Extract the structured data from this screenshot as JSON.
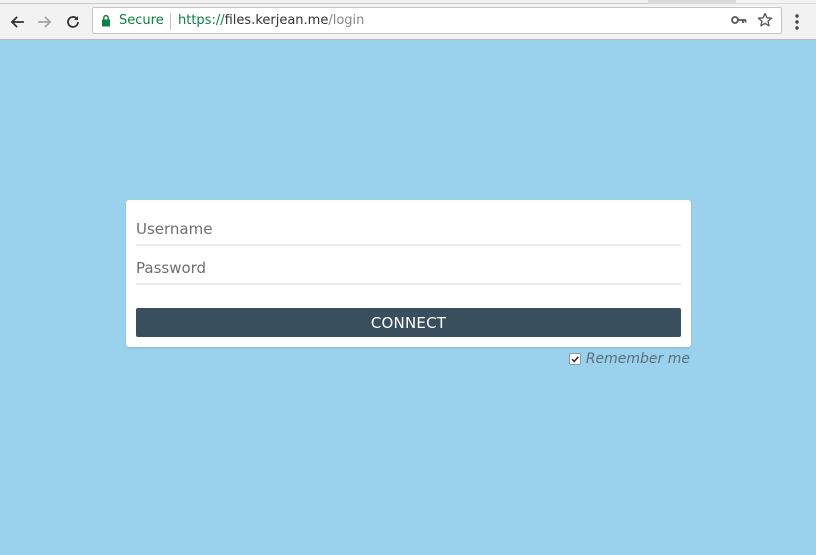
{
  "browser": {
    "security_label": "Secure",
    "url_scheme": "https://",
    "url_host": "files.kerjean.me",
    "url_path": "/login",
    "icons": {
      "back": "arrow-left-icon",
      "forward": "arrow-right-icon",
      "reload": "reload-icon",
      "lock": "lock-icon",
      "key": "key-icon",
      "star": "star-icon",
      "menu": "kebab-menu-icon"
    }
  },
  "login": {
    "username_placeholder": "Username",
    "password_placeholder": "Password",
    "connect_label": "CONNECT",
    "remember_label": "Remember me",
    "remember_checked": true
  },
  "colors": {
    "background": "#9ad1ec",
    "button": "#3a4f5e",
    "secure_green": "#0b8043"
  }
}
